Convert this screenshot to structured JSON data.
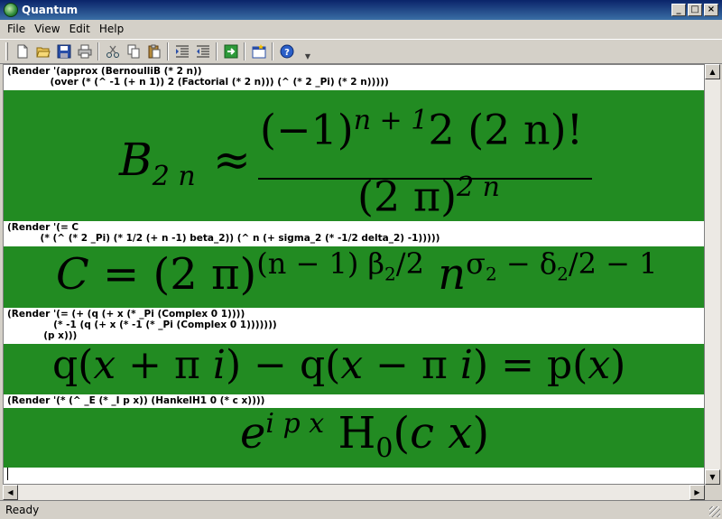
{
  "window": {
    "title": "Quantum",
    "min": "_",
    "max": "□",
    "close": "×"
  },
  "menu": [
    "File",
    "View",
    "Edit",
    "Help"
  ],
  "toolbar": {
    "icons": [
      "new-document-icon",
      "open-folder-icon",
      "save-disk-icon",
      "print-icon",
      "cut-scissors-icon",
      "copy-icon",
      "paste-icon",
      "indent-icon",
      "outdent-icon",
      "evaluate-arrow-icon",
      "new-window-icon",
      "help-icon"
    ]
  },
  "cells": [
    {
      "code": "(Render '(approx (BernoulliB (* 2 n))\n             (over (* (^ -1 (+ n 1)) 2 (Factorial (* 2 n))) (^ (* 2 _Pi) (* 2 n)))))",
      "math": {
        "lhs": "B",
        "lhs_sub": "2 n",
        "rel": "≈",
        "num_base": "(−1)",
        "num_exp": "n + 1",
        "num_rest": "2 (2 n)!",
        "den_base": "(2 π)",
        "den_exp": "2 n"
      }
    },
    {
      "code": "(Render '(= C\n          (* (^ (* 2 _Pi) (* 1/2 (+ n -1) beta_2)) (^ n (+ sigma_2 (* -1/2 delta_2) -1)))))",
      "math": {
        "lhs": "C",
        "rel": "=",
        "base1": "(2 π)",
        "exp1": "(n − 1) β",
        "exp1_sub": "2",
        "exp1_tail": "/2",
        "base2": "n",
        "exp2": "σ",
        "exp2_sub": "2",
        "exp2_mid": " − δ",
        "exp2_sub2": "2",
        "exp2_tail": "/2 − 1"
      }
    },
    {
      "code": "(Render '(= (+ (q (+ x (* _Pi (Complex 0 1))))\n              (* -1 (q (+ x (* -1 (* _Pi (Complex 0 1)))))))\n           (p x)))",
      "math": {
        "text_a": "q(",
        "x1": "x",
        "mid1": " + π ",
        "i1": "i",
        "text_b": ") − q(",
        "x2": "x",
        "mid2": " − π ",
        "i2": "i",
        "text_c": ") = p(",
        "x3": "x",
        "text_d": ")"
      }
    },
    {
      "code": "(Render '(* (^ _E (* _I p x)) (HankelH1 0 (* c x))))",
      "math": {
        "base": "e",
        "exp": "i p x",
        "func": "H",
        "func_sub": "0",
        "arg_open": "(",
        "arg": "c x",
        "arg_close": ")"
      }
    }
  ],
  "status": "Ready"
}
